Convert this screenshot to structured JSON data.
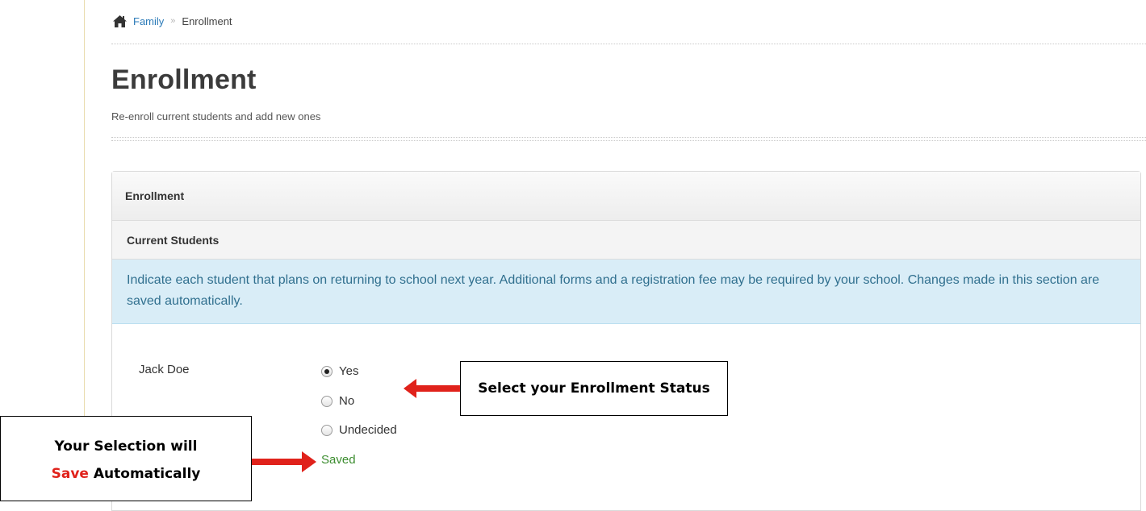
{
  "breadcrumb": {
    "home_icon": "home-icon",
    "link": "Family",
    "separator": "»",
    "current": "Enrollment"
  },
  "page": {
    "title": "Enrollment",
    "subtitle": "Re-enroll current students and add new ones"
  },
  "panel": {
    "title": "Enrollment",
    "section_title": "Current Students",
    "info_text": "Indicate each student that plans on returning to school next year. Additional forms and a registration fee may be required by your school. Changes made in this section are saved automatically."
  },
  "student": {
    "name": "Jack Doe",
    "options": [
      {
        "label": "Yes",
        "checked": true
      },
      {
        "label": "No",
        "checked": false
      },
      {
        "label": "Undecided",
        "checked": false
      }
    ],
    "status": "Saved"
  },
  "callouts": {
    "status_text": "Select your Enrollment Status",
    "save_line1": "Your Selection will",
    "save_accent": "Save",
    "save_rest": "Automatically"
  },
  "colors": {
    "link": "#2a7ab8",
    "info_bg": "#d9edf7",
    "info_text": "#31708f",
    "saved": "#3c8d2f",
    "arrow": "#e0221b"
  }
}
